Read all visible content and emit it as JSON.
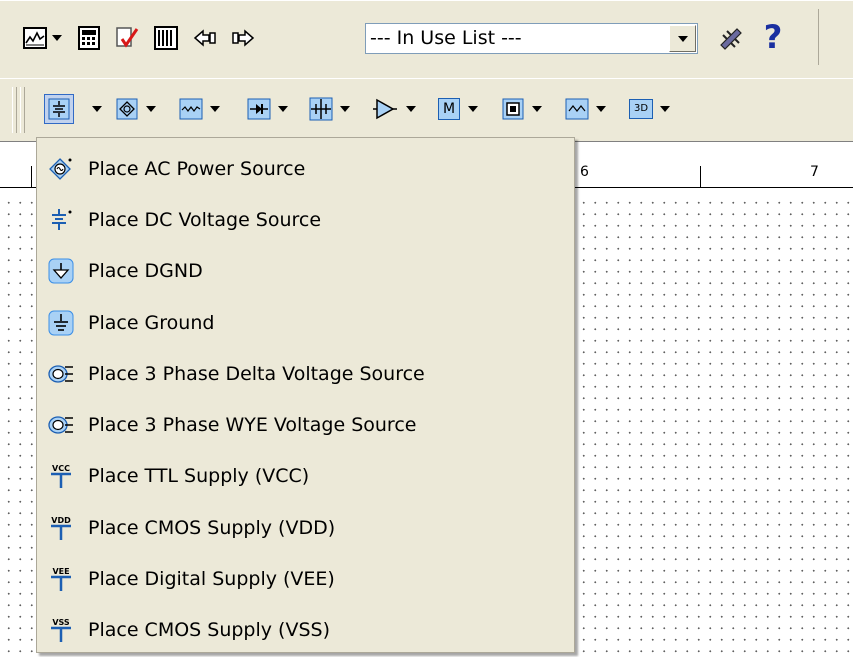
{
  "toolbar1": {
    "in_use_list": {
      "value": "--- In Use List ---"
    },
    "buttons": [
      "grapher-icon",
      "spreadsheet-icon",
      "erc-check-icon",
      "breadboard-icon",
      "back-annotate-icon",
      "forward-annotate-icon",
      "component-wizard-icon",
      "help-icon"
    ],
    "help_glyph": "?"
  },
  "toolbar2": {
    "buttons": [
      {
        "name": "sources-icon",
        "glyph": "≑"
      },
      {
        "name": "basic-icon",
        "glyph": ""
      },
      {
        "name": "diodes-icon",
        "glyph": ""
      },
      {
        "name": "transistors-icon",
        "glyph": ""
      },
      {
        "name": "analog-icon",
        "glyph": ""
      },
      {
        "name": "mcu-icon",
        "glyph": "M"
      },
      {
        "name": "misc-icon",
        "glyph": ""
      },
      {
        "name": "measurement-icon",
        "glyph": ""
      },
      {
        "name": "3d-icon",
        "glyph": "3D"
      }
    ]
  },
  "ruler": {
    "labels": [
      "6",
      "7"
    ]
  },
  "menu": {
    "items": [
      {
        "label": "Place AC Power Source",
        "icon": "ac-power-icon",
        "tag": ""
      },
      {
        "label": "Place DC Voltage Source",
        "icon": "dc-voltage-icon",
        "tag": ""
      },
      {
        "label": "Place DGND",
        "icon": "dgnd-icon",
        "tag": ""
      },
      {
        "label": "Place Ground",
        "icon": "ground-icon",
        "tag": ""
      },
      {
        "label": "Place 3 Phase Delta Voltage Source",
        "icon": "three-phase-delta-icon",
        "tag": ""
      },
      {
        "label": "Place 3 Phase WYE Voltage Source",
        "icon": "three-phase-wye-icon",
        "tag": ""
      },
      {
        "label": "Place TTL Supply (VCC)",
        "icon": "vcc-supply-icon",
        "tag": "VCC"
      },
      {
        "label": "Place CMOS Supply (VDD)",
        "icon": "vdd-supply-icon",
        "tag": "VDD"
      },
      {
        "label": "Place Digital Supply (VEE)",
        "icon": "vee-supply-icon",
        "tag": "VEE"
      },
      {
        "label": "Place CMOS Supply (VSS)",
        "icon": "vss-supply-icon",
        "tag": "VSS"
      }
    ]
  },
  "colors": {
    "menu_bg": "#ece9d8",
    "icon_blue": "#3a8ee6",
    "selection": "#316ac5"
  }
}
